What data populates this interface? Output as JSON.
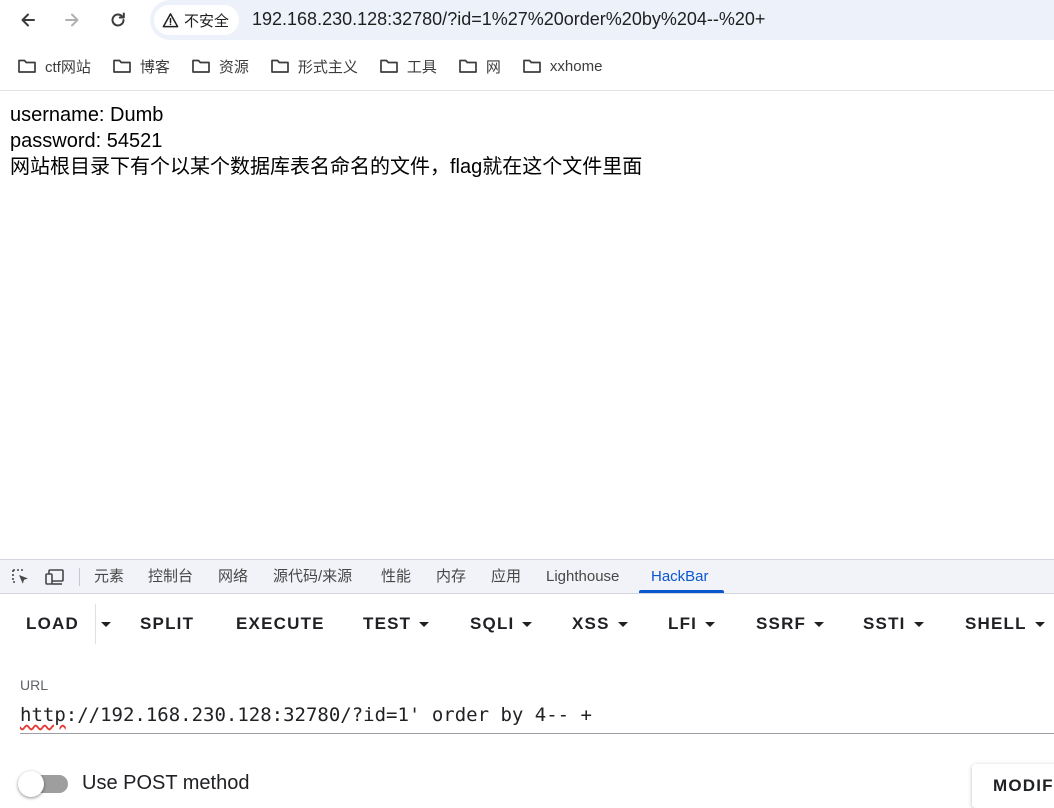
{
  "browser": {
    "security_label": "不安全",
    "url": "192.168.230.128:32780/?id=1%27%20order%20by%204--%20+"
  },
  "bookmarks": [
    {
      "label": "ctf网站"
    },
    {
      "label": "博客"
    },
    {
      "label": "资源"
    },
    {
      "label": "形式主义"
    },
    {
      "label": "工具"
    },
    {
      "label": "网"
    },
    {
      "label": "xxhome"
    }
  ],
  "page": {
    "username_line": "username: Dumb",
    "password_line": "password: 54521",
    "hint_line": "网站根目录下有个以某个数据库表名命名的文件，flag就在这个文件里面"
  },
  "devtools": {
    "tabs": [
      "元素",
      "控制台",
      "网络",
      "源代码/来源",
      "性能",
      "内存",
      "应用",
      "Lighthouse",
      "HackBar"
    ],
    "active_tab": "HackBar"
  },
  "hackbar": {
    "buttons": {
      "load": "LOAD",
      "split": "SPLIT",
      "execute": "EXECUTE",
      "test": "TEST",
      "sqli": "SQLI",
      "xss": "XSS",
      "lfi": "LFI",
      "ssrf": "SSRF",
      "ssti": "SSTI",
      "shell": "SHELL"
    },
    "url_label": "URL",
    "url_scheme": "http",
    "url_rest": "://192.168.230.128:32780/?id=1' order by 4-- +",
    "post_label": "Use POST method",
    "post_enabled": false,
    "modify_label": "MODIFY HEADER"
  },
  "colors": {
    "accent": "#0b57d0",
    "omnibox": "#edf2fa",
    "devtools_tabbar": "#f1f3f8"
  }
}
